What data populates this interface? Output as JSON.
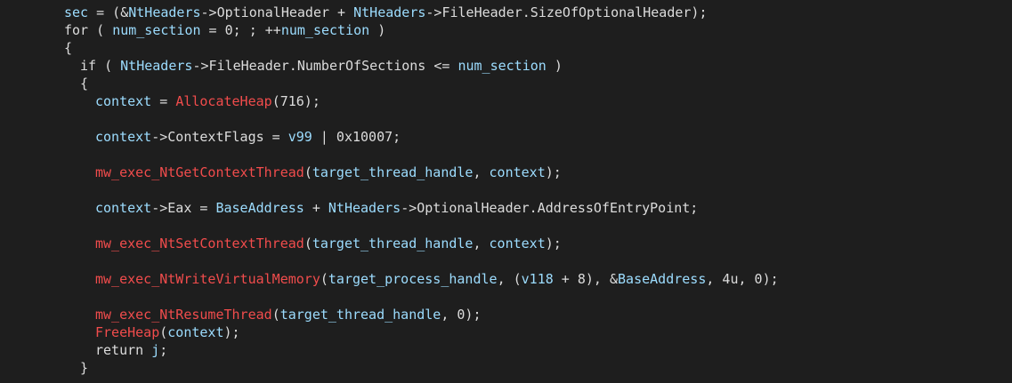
{
  "editor": {
    "background": "#1e1e1e",
    "colors": {
      "variable": "#9cdcfe",
      "function": "#f14c4c",
      "default": "#dcdcdc"
    },
    "lines": [
      {
        "indent": 72,
        "tokens": [
          {
            "t": "var",
            "v": "sec"
          },
          {
            "t": "plain",
            "v": " = (&"
          },
          {
            "t": "var",
            "v": "NtHeaders"
          },
          {
            "t": "plain",
            "v": "->OptionalHeader + "
          },
          {
            "t": "var",
            "v": "NtHeaders"
          },
          {
            "t": "plain",
            "v": "->FileHeader.SizeOfOptionalHeader);"
          }
        ]
      },
      {
        "indent": 72,
        "tokens": [
          {
            "t": "plain",
            "v": "for ( "
          },
          {
            "t": "var",
            "v": "num_section"
          },
          {
            "t": "plain",
            "v": " = 0; ; ++"
          },
          {
            "t": "var",
            "v": "num_section"
          },
          {
            "t": "plain",
            "v": " )"
          }
        ]
      },
      {
        "indent": 72,
        "tokens": [
          {
            "t": "plain",
            "v": "{"
          }
        ]
      },
      {
        "indent": 90,
        "tokens": [
          {
            "t": "plain",
            "v": "if ( "
          },
          {
            "t": "var",
            "v": "NtHeaders"
          },
          {
            "t": "plain",
            "v": "->FileHeader.NumberOfSections <= "
          },
          {
            "t": "var",
            "v": "num_section"
          },
          {
            "t": "plain",
            "v": " )"
          }
        ]
      },
      {
        "indent": 90,
        "tokens": [
          {
            "t": "plain",
            "v": "{"
          }
        ]
      },
      {
        "indent": 107,
        "tokens": [
          {
            "t": "var",
            "v": "context"
          },
          {
            "t": "plain",
            "v": " = "
          },
          {
            "t": "func",
            "v": "AllocateHeap"
          },
          {
            "t": "plain",
            "v": "(716);"
          }
        ]
      },
      {
        "indent": 107,
        "tokens": []
      },
      {
        "indent": 107,
        "tokens": [
          {
            "t": "var",
            "v": "context"
          },
          {
            "t": "plain",
            "v": "->ContextFlags = "
          },
          {
            "t": "var",
            "v": "v99"
          },
          {
            "t": "plain",
            "v": " | 0x10007;"
          }
        ]
      },
      {
        "indent": 107,
        "tokens": []
      },
      {
        "indent": 107,
        "tokens": [
          {
            "t": "func",
            "v": "mw_exec_NtGetContextThread"
          },
          {
            "t": "plain",
            "v": "("
          },
          {
            "t": "var",
            "v": "target_thread_handle"
          },
          {
            "t": "plain",
            "v": ", "
          },
          {
            "t": "var",
            "v": "context"
          },
          {
            "t": "plain",
            "v": ");"
          }
        ]
      },
      {
        "indent": 107,
        "tokens": []
      },
      {
        "indent": 107,
        "tokens": [
          {
            "t": "var",
            "v": "context"
          },
          {
            "t": "plain",
            "v": "->Eax = "
          },
          {
            "t": "var",
            "v": "BaseAddress"
          },
          {
            "t": "plain",
            "v": " + "
          },
          {
            "t": "var",
            "v": "NtHeaders"
          },
          {
            "t": "plain",
            "v": "->OptionalHeader.AddressOfEntryPoint;"
          }
        ]
      },
      {
        "indent": 107,
        "tokens": []
      },
      {
        "indent": 107,
        "tokens": [
          {
            "t": "func",
            "v": "mw_exec_NtSetContextThread"
          },
          {
            "t": "plain",
            "v": "("
          },
          {
            "t": "var",
            "v": "target_thread_handle"
          },
          {
            "t": "plain",
            "v": ", "
          },
          {
            "t": "var",
            "v": "context"
          },
          {
            "t": "plain",
            "v": ");"
          }
        ]
      },
      {
        "indent": 107,
        "tokens": []
      },
      {
        "indent": 107,
        "tokens": [
          {
            "t": "func",
            "v": "mw_exec_NtWriteVirtualMemory"
          },
          {
            "t": "plain",
            "v": "("
          },
          {
            "t": "var",
            "v": "target_process_handle"
          },
          {
            "t": "plain",
            "v": ", ("
          },
          {
            "t": "var",
            "v": "v118"
          },
          {
            "t": "plain",
            "v": " + 8), &"
          },
          {
            "t": "var",
            "v": "BaseAddress"
          },
          {
            "t": "plain",
            "v": ", 4u, 0);"
          }
        ]
      },
      {
        "indent": 107,
        "tokens": []
      },
      {
        "indent": 107,
        "tokens": [
          {
            "t": "func",
            "v": "mw_exec_NtResumeThread"
          },
          {
            "t": "plain",
            "v": "("
          },
          {
            "t": "var",
            "v": "target_thread_handle"
          },
          {
            "t": "plain",
            "v": ", 0);"
          }
        ]
      },
      {
        "indent": 107,
        "tokens": [
          {
            "t": "func",
            "v": "FreeHeap"
          },
          {
            "t": "plain",
            "v": "("
          },
          {
            "t": "var",
            "v": "context"
          },
          {
            "t": "plain",
            "v": ");"
          }
        ]
      },
      {
        "indent": 107,
        "tokens": [
          {
            "t": "plain",
            "v": "return "
          },
          {
            "t": "var",
            "v": "j"
          },
          {
            "t": "plain",
            "v": ";"
          }
        ]
      },
      {
        "indent": 90,
        "tokens": [
          {
            "t": "plain",
            "v": "}"
          }
        ]
      }
    ]
  }
}
